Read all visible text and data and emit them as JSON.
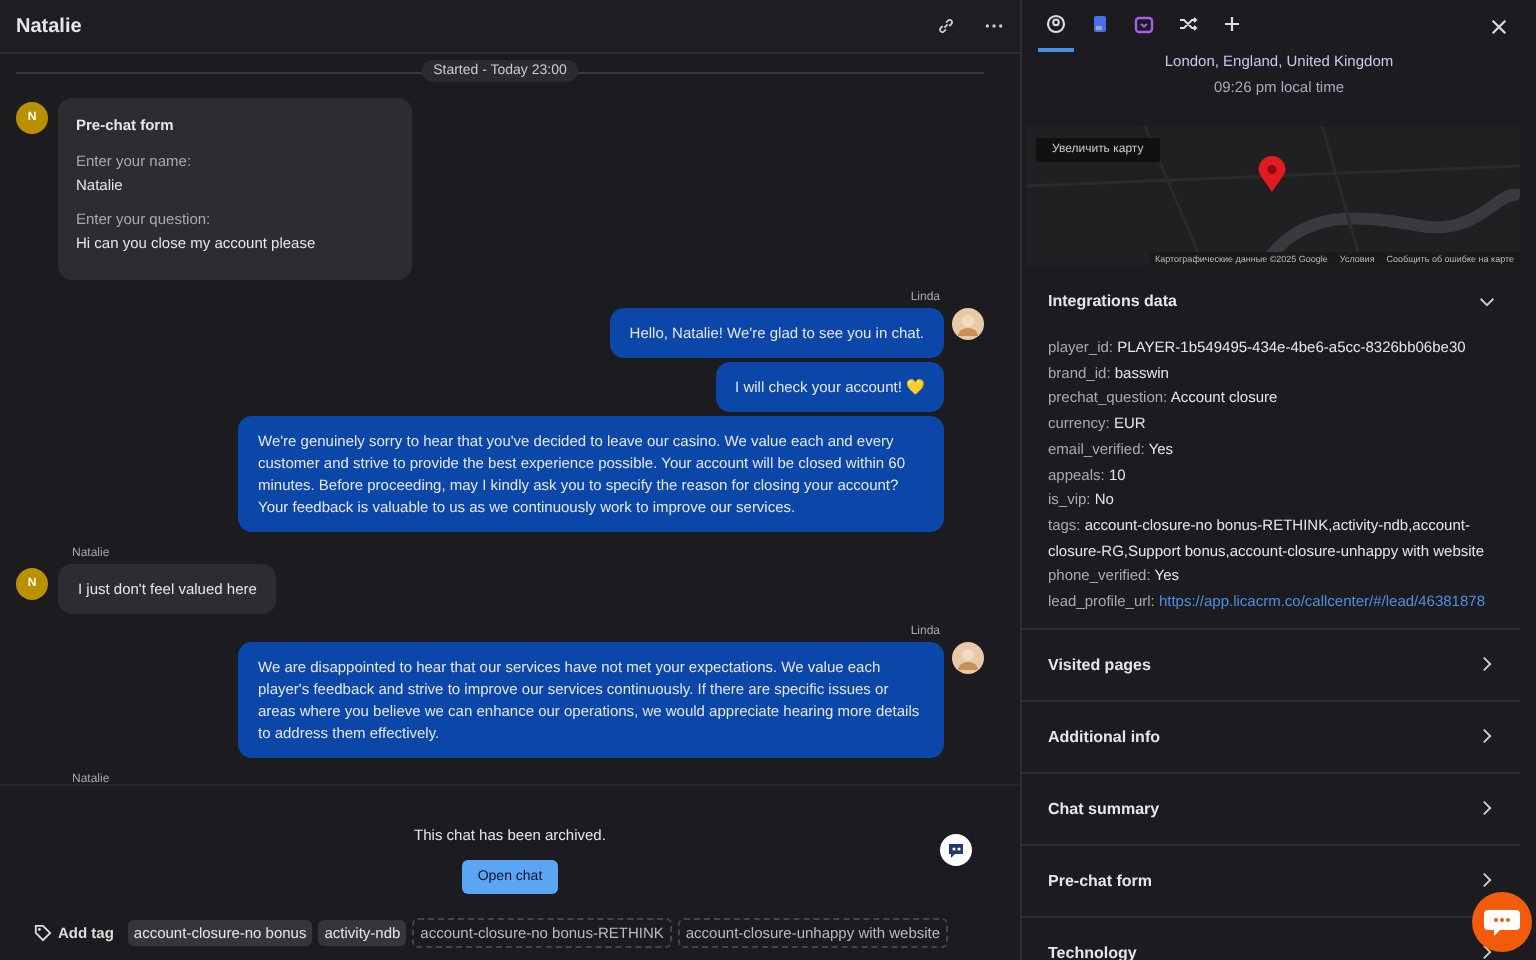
{
  "chat": {
    "title": "Natalie",
    "started": "Started - Today 23:00",
    "messages": [
      {
        "kind": "form",
        "title": "Pre-chat form",
        "fields": [
          {
            "label": "Enter your name:",
            "value": "Natalie"
          },
          {
            "label": "Enter your question:",
            "value": "Hi can you close my account please"
          }
        ],
        "avatar": "N"
      },
      {
        "kind": "agent",
        "author": "Linda",
        "bubbles": [
          "Hello, Natalie! We're glad to see you in chat.",
          "I will check your account! 💛",
          "We're genuinely sorry to hear that you've decided to leave our casino. We value each and every customer and strive to provide the best experience possible. Your account will be closed within 60 minutes. Before proceeding, may I kindly ask you to specify the reason for closing your account? Your feedback is valuable to us as we continuously work to improve our services."
        ]
      },
      {
        "kind": "visitor",
        "author": "Natalie",
        "avatar": "N",
        "bubbles": [
          "I just don't feel valued here"
        ]
      },
      {
        "kind": "agent",
        "author": "Linda",
        "bubbles": [
          "We are disappointed to hear that our services have not met your expectations. We value each player's feedback and strive to improve our services continuously. If there are specific issues or areas where you believe we can enhance our operations, we would appreciate hearing more details to address them effectively."
        ]
      },
      {
        "kind": "visitor",
        "author": "Natalie"
      }
    ],
    "archived": "This chat has been archived.",
    "open_button": "Open chat",
    "add_tag": "Add tag",
    "tags": [
      {
        "label": "account-closure-no bonus",
        "kind": "applied"
      },
      {
        "label": "activity-ndb",
        "kind": "applied"
      },
      {
        "label": "account-closure-no bonus-RETHINK",
        "kind": "suggested"
      },
      {
        "label": "account-closure-unhappy with website",
        "kind": "suggested"
      }
    ]
  },
  "details": {
    "tabs": [
      {
        "selected": true
      },
      {
        "selected": false
      },
      {
        "selected": false
      },
      {
        "selected": false
      },
      {
        "selected": false
      }
    ],
    "location": "London, England, United Kingdom",
    "local_time": "09:26 pm local time",
    "map": {
      "expand": "Увеличить карту",
      "attribution": "Картографические данные ©2025 Google",
      "terms": "Условия",
      "report": "Сообщить об ошибке на карте"
    },
    "sections": [
      {
        "title": "Integrations data",
        "expanded": true,
        "rows": [
          {
            "key": "player_id:",
            "value": "PLAYER-1b549495-434e-4be6-a5cc-8326bb06be30",
            "kind": "text"
          },
          {
            "key": "brand_id:",
            "value": "basswin",
            "kind": "text"
          },
          {
            "key": "prechat_question:",
            "value": "Account closure",
            "kind": "text"
          },
          {
            "key": "currency:",
            "value": "EUR",
            "kind": "text"
          },
          {
            "key": "email_verified:",
            "value": "Yes",
            "kind": "text"
          },
          {
            "key": "appeals:",
            "value": "10",
            "kind": "text"
          },
          {
            "key": "is_vip:",
            "value": "No",
            "kind": "text"
          },
          {
            "key": "tags:",
            "value": "account-closure-no bonus-RETHINK,activity-ndb,account-closure-RG,Support bonus,account-closure-unhappy with website",
            "kind": "text"
          },
          {
            "key": "phone_verified:",
            "value": "Yes",
            "kind": "text"
          },
          {
            "key": "lead_profile_url:",
            "value": "https://app.licacrm.co/callcenter/#/lead/46381878",
            "kind": "link"
          }
        ]
      },
      {
        "title": "Visited pages",
        "expanded": false
      },
      {
        "title": "Additional info",
        "expanded": false
      },
      {
        "title": "Chat summary",
        "expanded": false
      },
      {
        "title": "Pre-chat form",
        "expanded": false
      },
      {
        "title": "Technology",
        "expanded": false
      }
    ]
  }
}
